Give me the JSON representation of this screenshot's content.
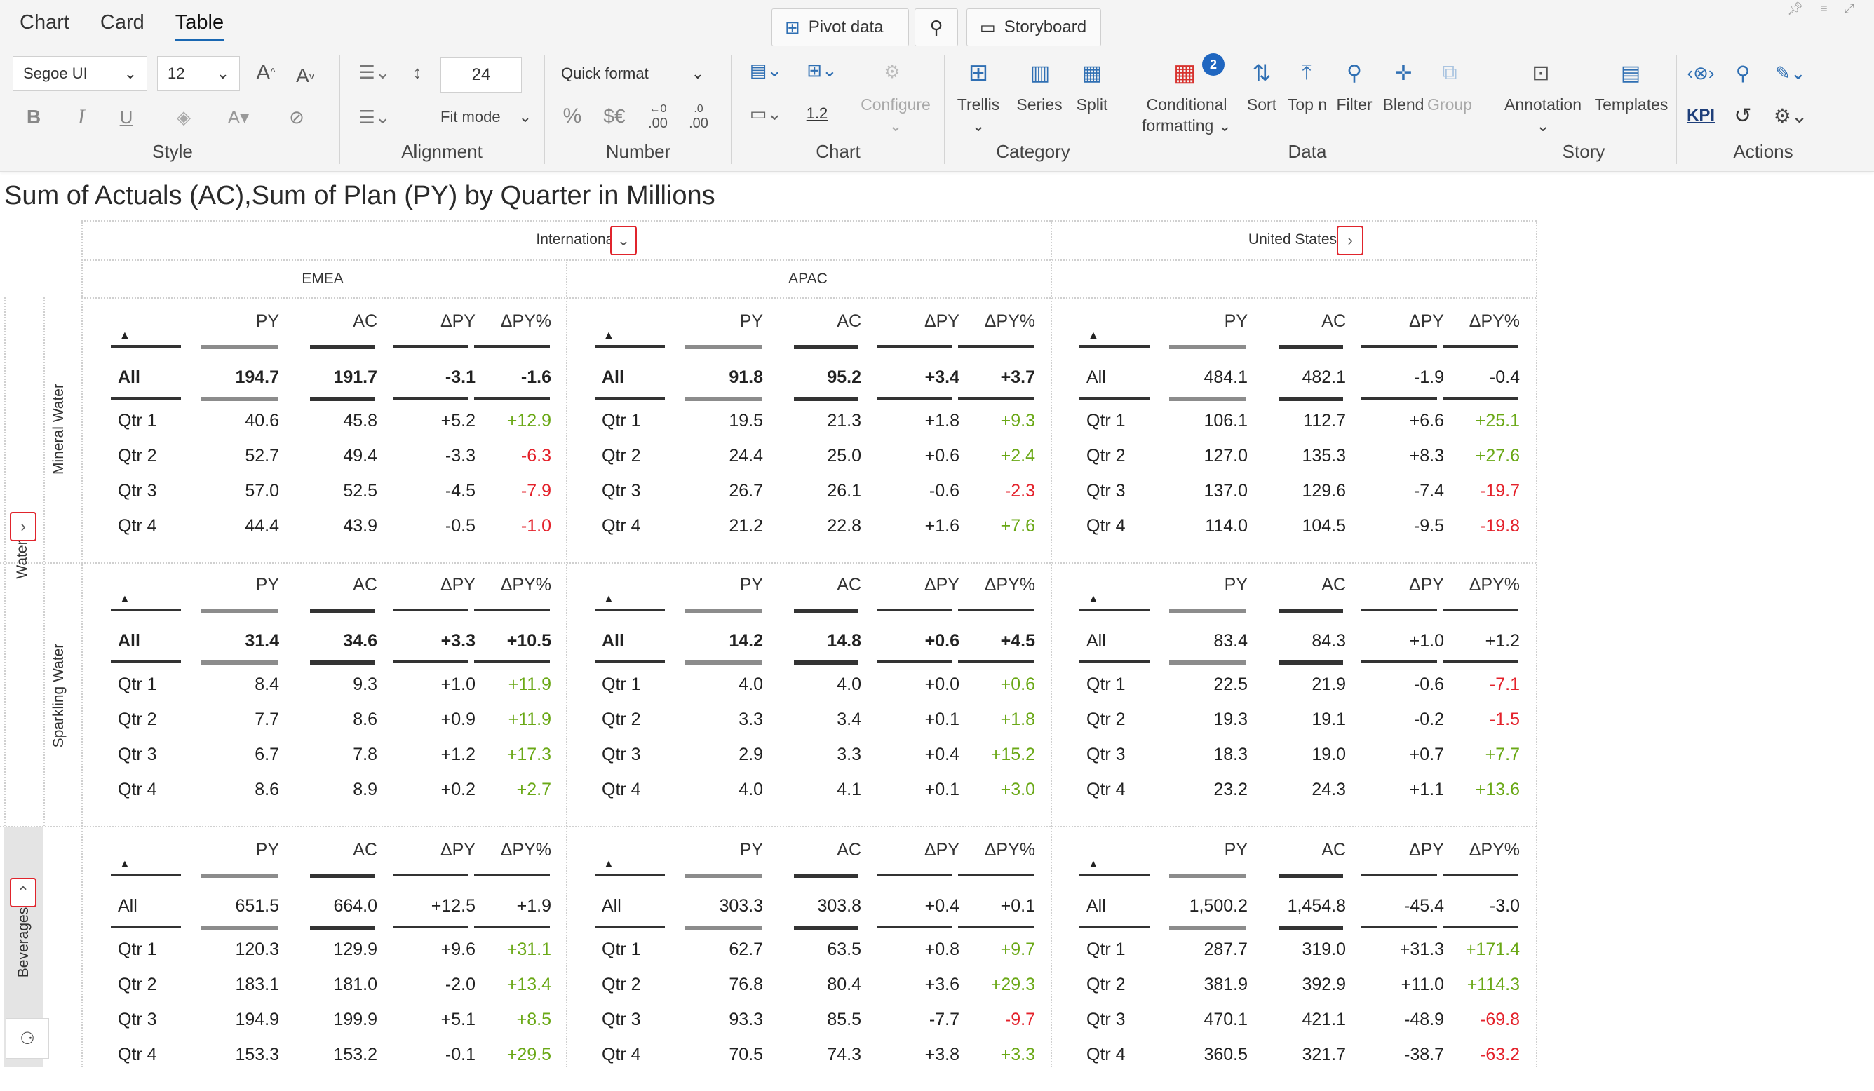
{
  "tabs": [
    "Chart",
    "Card",
    "Table"
  ],
  "active_tab": "Table",
  "top_buttons": {
    "pivot": "Pivot data",
    "storyboard": "Storyboard"
  },
  "style": {
    "font": "Segoe UI",
    "size": "12",
    "label": "Style"
  },
  "alignment": {
    "line_height": "24",
    "fit_mode": "Fit mode",
    "label": "Alignment"
  },
  "number": {
    "quick_format": "Quick format",
    "label": "Number",
    "percent": "%",
    "currency": "$€",
    "dec_less": ".00",
    "dec_more": ".00"
  },
  "chart": {
    "configure": "Configure",
    "label": "Chart",
    "scale": "1.2"
  },
  "category": {
    "trellis": "Trellis",
    "series": "Series",
    "split": "Split",
    "label": "Category"
  },
  "data_group": {
    "conditional": "Conditional",
    "formatting": "formatting",
    "badge": "2",
    "sort": "Sort",
    "topn": "Top n",
    "filter": "Filter",
    "blend": "Blend",
    "group": "Group",
    "label": "Data"
  },
  "story": {
    "annotation": "Annotation",
    "templates": "Templates",
    "label": "Story"
  },
  "actions": {
    "kpi": "KPI",
    "label": "Actions"
  },
  "title": "Sum of Actuals (AC),Sum of Plan (PY) by Quarter in Millions",
  "col_groups": {
    "international": "International",
    "united_states": "United States",
    "emea": "EMEA",
    "apac": "APAC"
  },
  "row_groups": {
    "water": "Water",
    "mineral": "Mineral Water",
    "sparkling": "Sparkling Water",
    "beverages": "Beverages"
  },
  "columns": [
    "PY",
    "AC",
    "ΔPY",
    "ΔPY%"
  ],
  "colors": {
    "py_bar": "#8c8c8c",
    "ac_bar": "#333333",
    "positive": "#6aa816",
    "negative": "#e4222b",
    "accent": "#1967b2"
  },
  "panels": [
    {
      "bold": true,
      "rows": [
        [
          "All",
          "194.7",
          "191.7",
          "-3.1",
          "-1.6"
        ],
        [
          "Qtr 1",
          "40.6",
          "45.8",
          "+5.2",
          "+12.9"
        ],
        [
          "Qtr 2",
          "52.7",
          "49.4",
          "-3.3",
          "-6.3"
        ],
        [
          "Qtr 3",
          "57.0",
          "52.5",
          "-4.5",
          "-7.9"
        ],
        [
          "Qtr 4",
          "44.4",
          "43.9",
          "-0.5",
          "-1.0"
        ]
      ]
    },
    {
      "bold": true,
      "rows": [
        [
          "All",
          "91.8",
          "95.2",
          "+3.4",
          "+3.7"
        ],
        [
          "Qtr 1",
          "19.5",
          "21.3",
          "+1.8",
          "+9.3"
        ],
        [
          "Qtr 2",
          "24.4",
          "25.0",
          "+0.6",
          "+2.4"
        ],
        [
          "Qtr 3",
          "26.7",
          "26.1",
          "-0.6",
          "-2.3"
        ],
        [
          "Qtr 4",
          "21.2",
          "22.8",
          "+1.6",
          "+7.6"
        ]
      ]
    },
    {
      "bold": false,
      "rows": [
        [
          "All",
          "484.1",
          "482.1",
          "-1.9",
          "-0.4"
        ],
        [
          "Qtr 1",
          "106.1",
          "112.7",
          "+6.6",
          "+25.1"
        ],
        [
          "Qtr 2",
          "127.0",
          "135.3",
          "+8.3",
          "+27.6"
        ],
        [
          "Qtr 3",
          "137.0",
          "129.6",
          "-7.4",
          "-19.7"
        ],
        [
          "Qtr 4",
          "114.0",
          "104.5",
          "-9.5",
          "-19.8"
        ]
      ]
    },
    {
      "bold": true,
      "rows": [
        [
          "All",
          "31.4",
          "34.6",
          "+3.3",
          "+10.5"
        ],
        [
          "Qtr 1",
          "8.4",
          "9.3",
          "+1.0",
          "+11.9"
        ],
        [
          "Qtr 2",
          "7.7",
          "8.6",
          "+0.9",
          "+11.9"
        ],
        [
          "Qtr 3",
          "6.7",
          "7.8",
          "+1.2",
          "+17.3"
        ],
        [
          "Qtr 4",
          "8.6",
          "8.9",
          "+0.2",
          "+2.7"
        ]
      ]
    },
    {
      "bold": true,
      "rows": [
        [
          "All",
          "14.2",
          "14.8",
          "+0.6",
          "+4.5"
        ],
        [
          "Qtr 1",
          "4.0",
          "4.0",
          "+0.0",
          "+0.6"
        ],
        [
          "Qtr 2",
          "3.3",
          "3.4",
          "+0.1",
          "+1.8"
        ],
        [
          "Qtr 3",
          "2.9",
          "3.3",
          "+0.4",
          "+15.2"
        ],
        [
          "Qtr 4",
          "4.0",
          "4.1",
          "+0.1",
          "+3.0"
        ]
      ]
    },
    {
      "bold": false,
      "rows": [
        [
          "All",
          "83.4",
          "84.3",
          "+1.0",
          "+1.2"
        ],
        [
          "Qtr 1",
          "22.5",
          "21.9",
          "-0.6",
          "-7.1"
        ],
        [
          "Qtr 2",
          "19.3",
          "19.1",
          "-0.2",
          "-1.5"
        ],
        [
          "Qtr 3",
          "18.3",
          "19.0",
          "+0.7",
          "+7.7"
        ],
        [
          "Qtr 4",
          "23.2",
          "24.3",
          "+1.1",
          "+13.6"
        ]
      ]
    },
    {
      "bold": false,
      "rows": [
        [
          "All",
          "651.5",
          "664.0",
          "+12.5",
          "+1.9"
        ],
        [
          "Qtr 1",
          "120.3",
          "129.9",
          "+9.6",
          "+31.1"
        ],
        [
          "Qtr 2",
          "183.1",
          "181.0",
          "-2.0",
          "+13.4"
        ],
        [
          "Qtr 3",
          "194.9",
          "199.9",
          "+5.1",
          "+8.5"
        ],
        [
          "Qtr 4",
          "153.3",
          "153.2",
          "-0.1",
          "+29.5"
        ]
      ]
    },
    {
      "bold": false,
      "rows": [
        [
          "All",
          "303.3",
          "303.8",
          "+0.4",
          "+0.1"
        ],
        [
          "Qtr 1",
          "62.7",
          "63.5",
          "+0.8",
          "+9.7"
        ],
        [
          "Qtr 2",
          "76.8",
          "80.4",
          "+3.6",
          "+29.3"
        ],
        [
          "Qtr 3",
          "93.3",
          "85.5",
          "-7.7",
          "-9.7"
        ],
        [
          "Qtr 4",
          "70.5",
          "74.3",
          "+3.8",
          "+3.3"
        ]
      ]
    },
    {
      "bold": false,
      "rows": [
        [
          "All",
          "1,500.2",
          "1,454.8",
          "-45.4",
          "-3.0"
        ],
        [
          "Qtr 1",
          "287.7",
          "319.0",
          "+31.3",
          "+171.4"
        ],
        [
          "Qtr 2",
          "381.9",
          "392.9",
          "+11.0",
          "+114.3"
        ],
        [
          "Qtr 3",
          "470.1",
          "421.1",
          "-48.9",
          "-69.8"
        ],
        [
          "Qtr 4",
          "360.5",
          "321.7",
          "-38.7",
          "-63.2"
        ]
      ]
    }
  ]
}
